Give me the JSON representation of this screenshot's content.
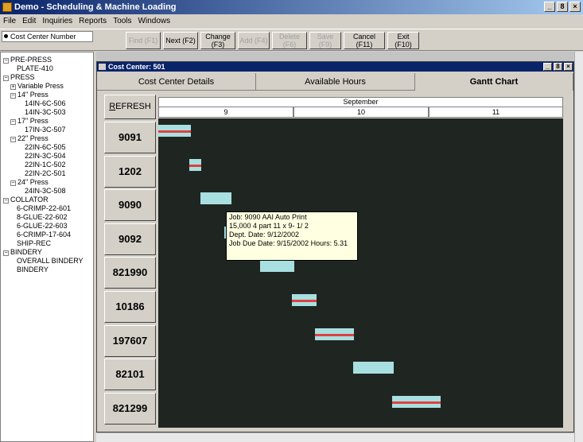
{
  "window": {
    "title": "Demo - Scheduling & Machine Loading",
    "btn_min": "_",
    "btn_max": "8",
    "btn_close": "×"
  },
  "menu": [
    "File",
    "Edit",
    "Inquiries",
    "Reports",
    "Tools",
    "Windows"
  ],
  "toolbar": {
    "cost_center_select": "Cost Center Number",
    "buttons": [
      {
        "label": "Find (F1)",
        "enabled": false
      },
      {
        "label": "Next (F2)",
        "enabled": true
      },
      {
        "label": "Change (F3)",
        "enabled": true
      },
      {
        "label": "Add (F4)",
        "enabled": false
      },
      {
        "label": "Delete (F6)",
        "enabled": false
      },
      {
        "label": "Save (F9)",
        "enabled": false
      },
      {
        "label": "Cancel (F11)",
        "enabled": true
      },
      {
        "label": "Exit (F10)",
        "enabled": true
      }
    ]
  },
  "tree": [
    {
      "label": "PRE-PRESS",
      "box": "−"
    },
    {
      "label": "PLATE-410",
      "box": ""
    },
    {
      "label": "PRESS",
      "box": "−"
    },
    {
      "label": "Variable Press",
      "box": "+"
    },
    {
      "label": "14\" Press",
      "box": "−"
    },
    {
      "label": "14IN-6C-506",
      "box": ""
    },
    {
      "label": "14IN-3C-503",
      "box": ""
    },
    {
      "label": "17\" Press",
      "box": "−"
    },
    {
      "label": "17IN-3C-507",
      "box": ""
    },
    {
      "label": "22\" Press",
      "box": "−"
    },
    {
      "label": "22IN-6C-505",
      "box": ""
    },
    {
      "label": "22IN-3C-504",
      "box": ""
    },
    {
      "label": "22IN-1C-502",
      "box": ""
    },
    {
      "label": "22IN-2C-501",
      "box": ""
    },
    {
      "label": "24\" Press",
      "box": "−"
    },
    {
      "label": "24IN-3C-508",
      "box": ""
    },
    {
      "label": "COLLATOR",
      "box": "−"
    },
    {
      "label": "6-CRIMP-22-601",
      "box": ""
    },
    {
      "label": "8-GLUE-22-602",
      "box": ""
    },
    {
      "label": "6-GLUE-22-603",
      "box": ""
    },
    {
      "label": "6-CRIMP-17-604",
      "box": ""
    },
    {
      "label": "SHIP-REC",
      "box": ""
    },
    {
      "label": "BINDERY",
      "box": "−"
    },
    {
      "label": "OVERALL BINDERY",
      "box": ""
    },
    {
      "label": "BINDERY",
      "box": ""
    }
  ],
  "child_window": {
    "title": "Cost Center: 501",
    "tabs": [
      "Cost Center Details",
      "Available Hours",
      "Gantt Chart"
    ],
    "active_tab": "Gantt Chart"
  },
  "gantt": {
    "refresh_label": "REFRESH",
    "month": "September",
    "days": [
      "9",
      "10",
      "11"
    ],
    "colors": {
      "bar": "#a8dfe0",
      "late_line": "#e04040",
      "background": "#1f2520"
    },
    "jobs": [
      {
        "id": "9091",
        "start": 9.0,
        "end": 9.24,
        "late": true
      },
      {
        "id": "1202",
        "start": 9.23,
        "end": 9.32,
        "late": true
      },
      {
        "id": "9090",
        "start": 9.31,
        "end": 9.54,
        "late": false
      },
      {
        "id": "9092",
        "start": 9.49,
        "end": 9.53,
        "late": false
      },
      {
        "id": "821990",
        "start": 9.75,
        "end": 10.0,
        "late": false
      },
      {
        "id": "10186",
        "start": 9.99,
        "end": 10.17,
        "late": true
      },
      {
        "id": "197607",
        "start": 10.16,
        "end": 10.45,
        "late": true
      },
      {
        "id": "82101",
        "start": 10.44,
        "end": 10.74,
        "late": false
      },
      {
        "id": "821299",
        "start": 10.73,
        "end": 11.09,
        "late": true
      }
    ],
    "tooltip": [
      "Job: 9090  AAI Auto Print",
      "15,000  4 part  11 x  9- 1/ 2",
      "  Dept. Date: 9/12/2002",
      "Job Due Date: 9/15/2002   Hours: 5.31"
    ]
  }
}
